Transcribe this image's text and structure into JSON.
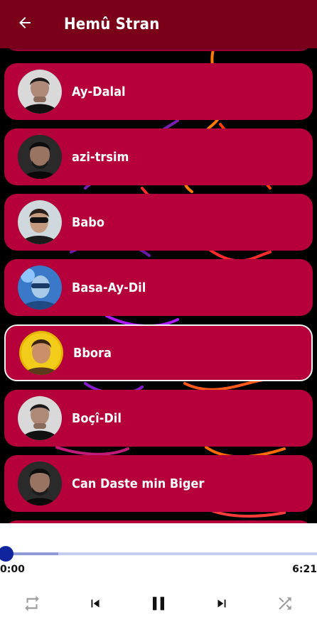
{
  "header": {
    "title": "Hemû Stran",
    "back_icon": "arrow-back-icon"
  },
  "songs": [
    {
      "title": "",
      "avatar": "singer-portrait-1"
    },
    {
      "title": "Ay-Dalal",
      "avatar": "singer-portrait-1"
    },
    {
      "title": "azi-trsim",
      "avatar": "singer-portrait-2"
    },
    {
      "title": "Babo",
      "avatar": "singer-portrait-3"
    },
    {
      "title": "Basa-Ay-Dil",
      "avatar": "singer-portrait-4"
    },
    {
      "title": "Bbora",
      "avatar": "singer-portrait-5",
      "selected": true
    },
    {
      "title": "Boçî-Dil",
      "avatar": "singer-portrait-1"
    },
    {
      "title": "Can Daste min Biger",
      "avatar": "singer-portrait-2"
    },
    {
      "title": "",
      "avatar": "singer-portrait-1"
    }
  ],
  "player": {
    "current_time": "0:00",
    "duration": "6:21",
    "progress": 0.0,
    "buffered": 0.17,
    "controls": [
      "repeat-icon",
      "skip-previous-icon",
      "pause-icon",
      "skip-next-icon",
      "shuffle-icon"
    ]
  },
  "colors": {
    "appbar": "#7a0019",
    "card": "#b6003b",
    "accent": "#10249e"
  }
}
